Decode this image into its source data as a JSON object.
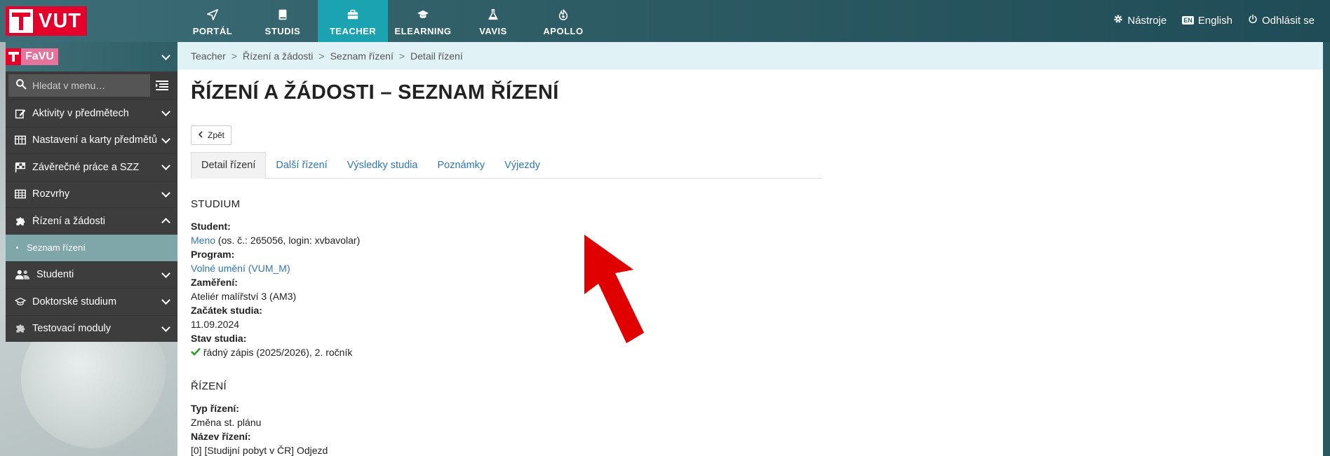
{
  "brand": {
    "name": "VUT"
  },
  "nav": [
    {
      "label": "PORTÁL",
      "icon": "paper-plane-icon",
      "active": false
    },
    {
      "label": "STUDIS",
      "icon": "book-icon",
      "active": false
    },
    {
      "label": "TEACHER",
      "icon": "briefcase-icon",
      "active": true
    },
    {
      "label": "ELEARNING",
      "icon": "graduation-cap-icon",
      "active": false
    },
    {
      "label": "VAVIS",
      "icon": "flask-icon",
      "active": false
    },
    {
      "label": "APOLLO",
      "icon": "flame-icon",
      "active": false
    }
  ],
  "top_right": {
    "tools": "Nástroje",
    "lang_badge": "EN",
    "language": "English",
    "logout": "Odhlásit se"
  },
  "sidebar": {
    "faculty": "FaVU",
    "search_placeholder": "Hledat v menu…",
    "items": [
      {
        "label": "Aktivity v předmětech",
        "icon": "edit-icon"
      },
      {
        "label": "Nastavení a karty předmětů",
        "icon": "columns-icon"
      },
      {
        "label": "Závěrečné práce a SZZ",
        "icon": "flag-checkered-icon"
      },
      {
        "label": "Rozvrhy",
        "icon": "table-icon"
      },
      {
        "label": "Řízení a žádosti",
        "icon": "puzzle-icon",
        "open": true
      },
      {
        "label": "Studenti",
        "icon": "users-icon"
      },
      {
        "label": "Doktorské studium",
        "icon": "graduation-cap-icon"
      },
      {
        "label": "Testovací moduly",
        "icon": "puzzle-icon"
      }
    ],
    "subitem": "Seznam řízení"
  },
  "breadcrumb": [
    "Teacher",
    "Řízení a žádosti",
    "Seznam řízení",
    "Detail řízení"
  ],
  "page_title": "ŘÍZENÍ A ŽÁDOSTI – SEZNAM ŘÍZENÍ",
  "back_label": "Zpět",
  "tabs": [
    "Detail řízení",
    "Další řízení",
    "Výsledky studia",
    "Poznámky",
    "Výjezdy"
  ],
  "studium": {
    "title": "STUDIUM",
    "student_label": "Student:",
    "student_name": "Meno",
    "student_info": " (os. č.: 265056, login: xvbavolar)",
    "program_label": "Program:",
    "program_value": "Volné umění (VUM_M)",
    "zamereni_label": "Zaměření:",
    "zamereni_value": "Ateliér malířství 3 (AM3)",
    "zacatek_label": "Začátek studia:",
    "zacatek_value": "11.09.2024",
    "stav_label": "Stav studia:",
    "stav_value": "řádný zápis (2025/2026), 2. ročník"
  },
  "rizeni": {
    "title": "ŘÍZENÍ",
    "typ_label": "Typ řízení:",
    "typ_value": "Změna st. plánu",
    "nazev_label": "Název řízení:",
    "nazev_value": "[0] [Studijní pobyt v ČR] Odjezd"
  },
  "colors": {
    "accent": "#1ba3b1",
    "brand": "#e4002b",
    "link": "#2f76b8",
    "arrow": "#e00000"
  }
}
